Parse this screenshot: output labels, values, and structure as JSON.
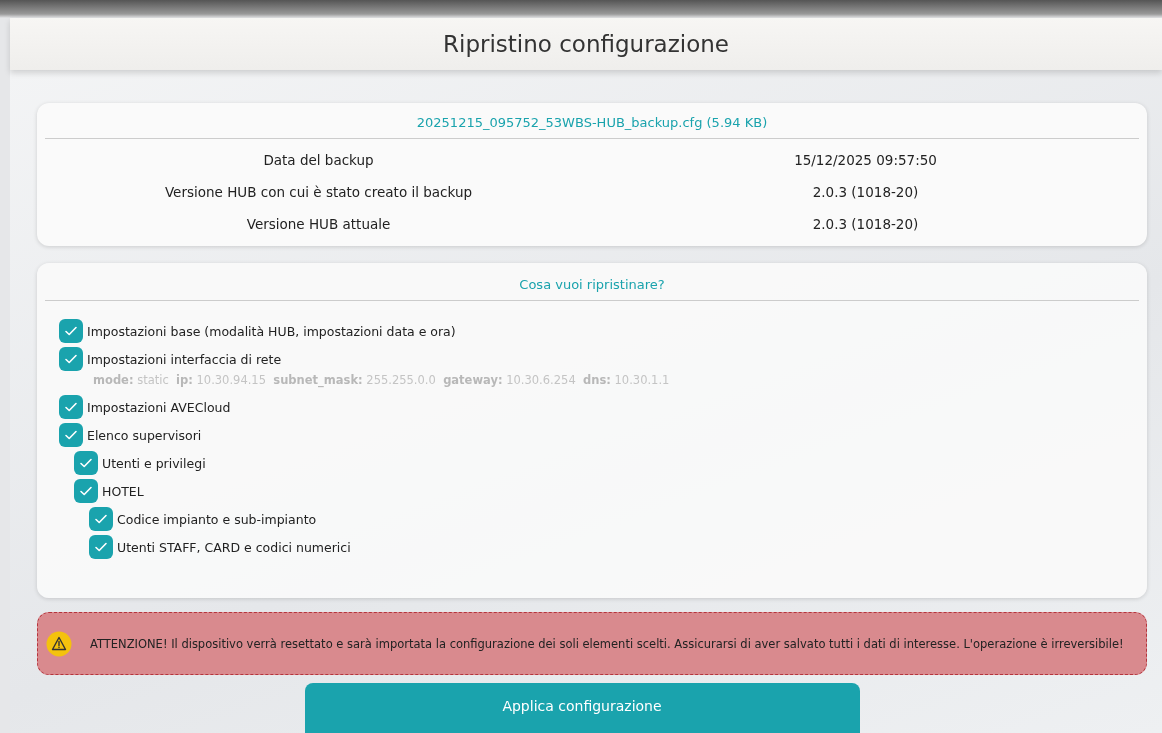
{
  "header": {
    "title": "Ripristino configurazione"
  },
  "backup_info": {
    "file": "20251215_095752_53WBS-HUB_backup.cfg (5.94 KB)",
    "rows": [
      {
        "label": "Data del backup",
        "value": "15/12/2025 09:57:50"
      },
      {
        "label": "Versione HUB con cui è stato creato il backup",
        "value": "2.0.3 (1018-20)"
      },
      {
        "label": "Versione HUB attuale",
        "value": "2.0.3 (1018-20)"
      }
    ]
  },
  "restore_options": {
    "title": "Cosa vuoi ripristinare?",
    "items": [
      {
        "label": "Impostazioni base (modalità HUB, impostazioni data e ora)",
        "checked": true
      },
      {
        "label": "Impostazioni interfaccia di rete",
        "checked": true,
        "details": "**mode:** static  **ip:** 10.30.94.15  **subnet_mask:** 255.255.0.0  **gateway:** 10.30.6.254  **dns:** 10.30.1.1"
      },
      {
        "label": "Impostazioni AVECloud",
        "checked": true
      },
      {
        "label": "Elenco supervisori",
        "checked": true,
        "children": [
          {
            "label": "Utenti e privilegi",
            "checked": true
          },
          {
            "label": "HOTEL",
            "checked": true,
            "children": [
              {
                "label": "Codice impianto e sub-impianto",
                "checked": true
              },
              {
                "label": "Utenti STAFF, CARD e codici numerici",
                "checked": true
              }
            ]
          }
        ]
      }
    ]
  },
  "warning": {
    "text": "ATTENZIONE! Il dispositivo verrà resettato e sarà importata la configurazione dei soli elementi scelti. Assicurarsi di aver salvato tutti i dati di interesse. L'operazione è irreversibile!"
  },
  "apply_button": {
    "label": "Applica configurazione"
  }
}
